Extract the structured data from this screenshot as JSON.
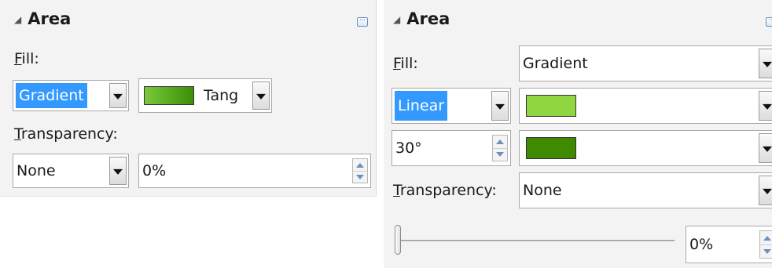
{
  "left": {
    "title": "Area",
    "fill_label_accel": "F",
    "fill_label_rest": "ill:",
    "fill_type": "Gradient",
    "gradient_name": "Tang",
    "transparency_label_accel": "T",
    "transparency_label_rest": "ransparency:",
    "transparency_mode": "None",
    "transparency_value": "0%"
  },
  "right": {
    "title": "Area",
    "fill_label_accel": "F",
    "fill_label_rest": "ill:",
    "fill_type": "Gradient",
    "gradient_type": "Linear",
    "angle": "30°",
    "transparency_label_accel": "T",
    "transparency_label_rest": "ransparency:",
    "transparency_mode": "None",
    "transparency_value": "0%"
  },
  "colors": {
    "gradient_light": "#8fd640",
    "gradient_dark": "#3f8a00",
    "left_swatch_start": "#7ac83a",
    "left_swatch_end": "#3a8f08",
    "selection": "#3399ff"
  },
  "icons": {
    "collapse": "triangle-icon",
    "more_options": "more-options-icon",
    "dropdown": "chevron-down-icon",
    "spinner": "spin-arrows-icon"
  }
}
